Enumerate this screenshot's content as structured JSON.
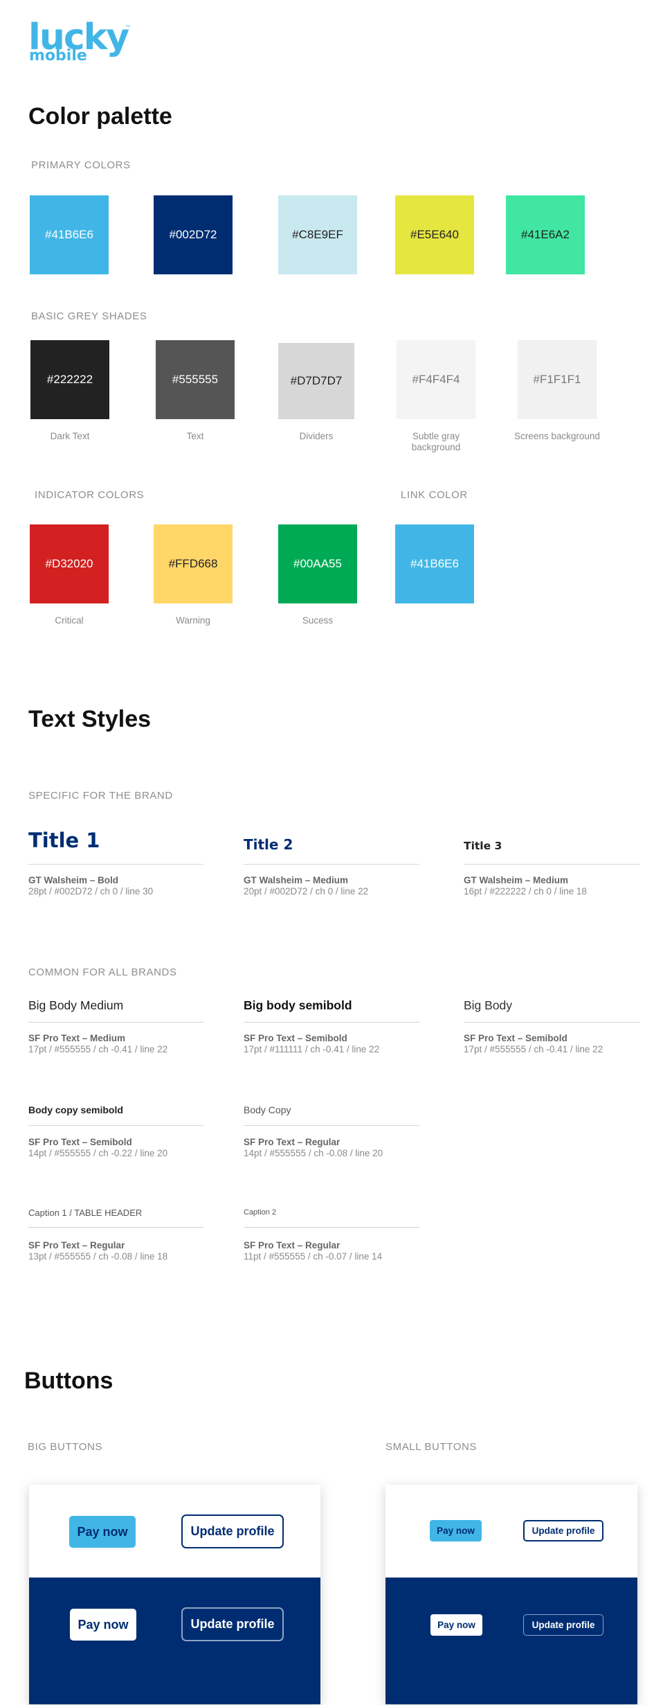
{
  "logo": {
    "word": "lucky",
    "sub": "mobile",
    "tm": "™"
  },
  "color_palette": {
    "title": "Color palette",
    "primary_label": "PRIMARY COLORS",
    "primary": [
      {
        "hex": "#41B6E6",
        "color": "#41B6E6",
        "text_color": "#ffffff"
      },
      {
        "hex": "#002D72",
        "color": "#002D72",
        "text_color": "#ffffff"
      },
      {
        "hex": "#C8E9EF",
        "color": "#C8E9EF",
        "text_color": "#222222"
      },
      {
        "hex": "#E5E640",
        "color": "#E5E640",
        "text_color": "#222222"
      },
      {
        "hex": "#41E6A2",
        "color": "#41E6A2",
        "text_color": "#222222"
      }
    ],
    "grey_label": "BASIC GREY SHADES",
    "grey": [
      {
        "hex": "#222222",
        "color": "#222222",
        "text_color": "#ffffff",
        "caption": "Dark Text"
      },
      {
        "hex": "#555555",
        "color": "#555555",
        "text_color": "#ffffff",
        "caption": "Text"
      },
      {
        "hex": "#D7D7D7",
        "color": "#D7D7D7",
        "text_color": "#222222",
        "caption": "Dividers"
      },
      {
        "hex": "#F4F4F4",
        "color": "#F4F4F4",
        "text_color": "#777777",
        "caption": "Subtle gray background"
      },
      {
        "hex": "#F1F1F1",
        "color": "#F1F1F1",
        "text_color": "#777777",
        "caption": "Screens background"
      }
    ],
    "indicator_label": "INDICATOR COLORS",
    "link_label": "LINK COLOR",
    "indicator": [
      {
        "hex": "#D32020",
        "color": "#D32020",
        "text_color": "#ffffff",
        "caption": "Critical"
      },
      {
        "hex": "#FFD668",
        "color": "#FFD668",
        "text_color": "#222222",
        "caption": "Warning"
      },
      {
        "hex": "#00AA55",
        "color": "#00AA55",
        "text_color": "#ffffff",
        "caption": "Sucess"
      }
    ],
    "link": {
      "hex": "#41B6E6",
      "color": "#41B6E6",
      "text_color": "#ffffff"
    }
  },
  "text_styles": {
    "title": "Text Styles",
    "brand_label": "SPECIFIC FOR THE BRAND",
    "brand": [
      {
        "sample": "Title 1",
        "font": "GT Walsheim – Bold",
        "spec": "28pt / #002D72 / ch 0 / line 30",
        "color": "#002D72"
      },
      {
        "sample": "Title 2",
        "font": "GT Walsheim – Medium",
        "spec": "20pt / #002D72 / ch 0 / line 22",
        "color": "#002D72"
      },
      {
        "sample": "Title 3",
        "font": "GT Walsheim – Medium",
        "spec": "16pt / #222222 / ch 0 / line 18",
        "color": "#222222"
      }
    ],
    "common_label": "COMMON FOR ALL BRANDS",
    "common": [
      {
        "sample": "Big Body Medium",
        "font": "SF Pro Text – Medium",
        "spec": "17pt / #555555 / ch -0.41 / line 22"
      },
      {
        "sample": "Big body semibold",
        "font": "SF Pro Text – Semibold",
        "spec": "17pt / #111111 / ch -0.41 / line 22"
      },
      {
        "sample": "Big Body",
        "font": "SF Pro Text – Semibold",
        "spec": "17pt / #555555 / ch -0.41 / line 22"
      },
      {
        "sample": "Body copy semibold",
        "font": "SF Pro Text – Semibold",
        "spec": "14pt / #555555 / ch -0.22 / line 20"
      },
      {
        "sample": "Body Copy",
        "font": "SF Pro Text – Regular",
        "spec": "14pt / #555555 / ch -0.08 / line 20"
      },
      {
        "sample": "Caption 1 / TABLE HEADER",
        "font": "SF Pro Text – Regular",
        "spec": "13pt / #555555 / ch -0.08 / line 18"
      },
      {
        "sample": "Caption 2",
        "font": "SF Pro Text – Regular",
        "spec": "11pt / #555555 / ch -0.07 / line 14"
      }
    ]
  },
  "buttons": {
    "title": "Buttons",
    "big_label": "BIG BUTTONS",
    "small_label": "SMALL BUTTONS",
    "pay_now": "Pay now",
    "update_profile": "Update profile"
  }
}
